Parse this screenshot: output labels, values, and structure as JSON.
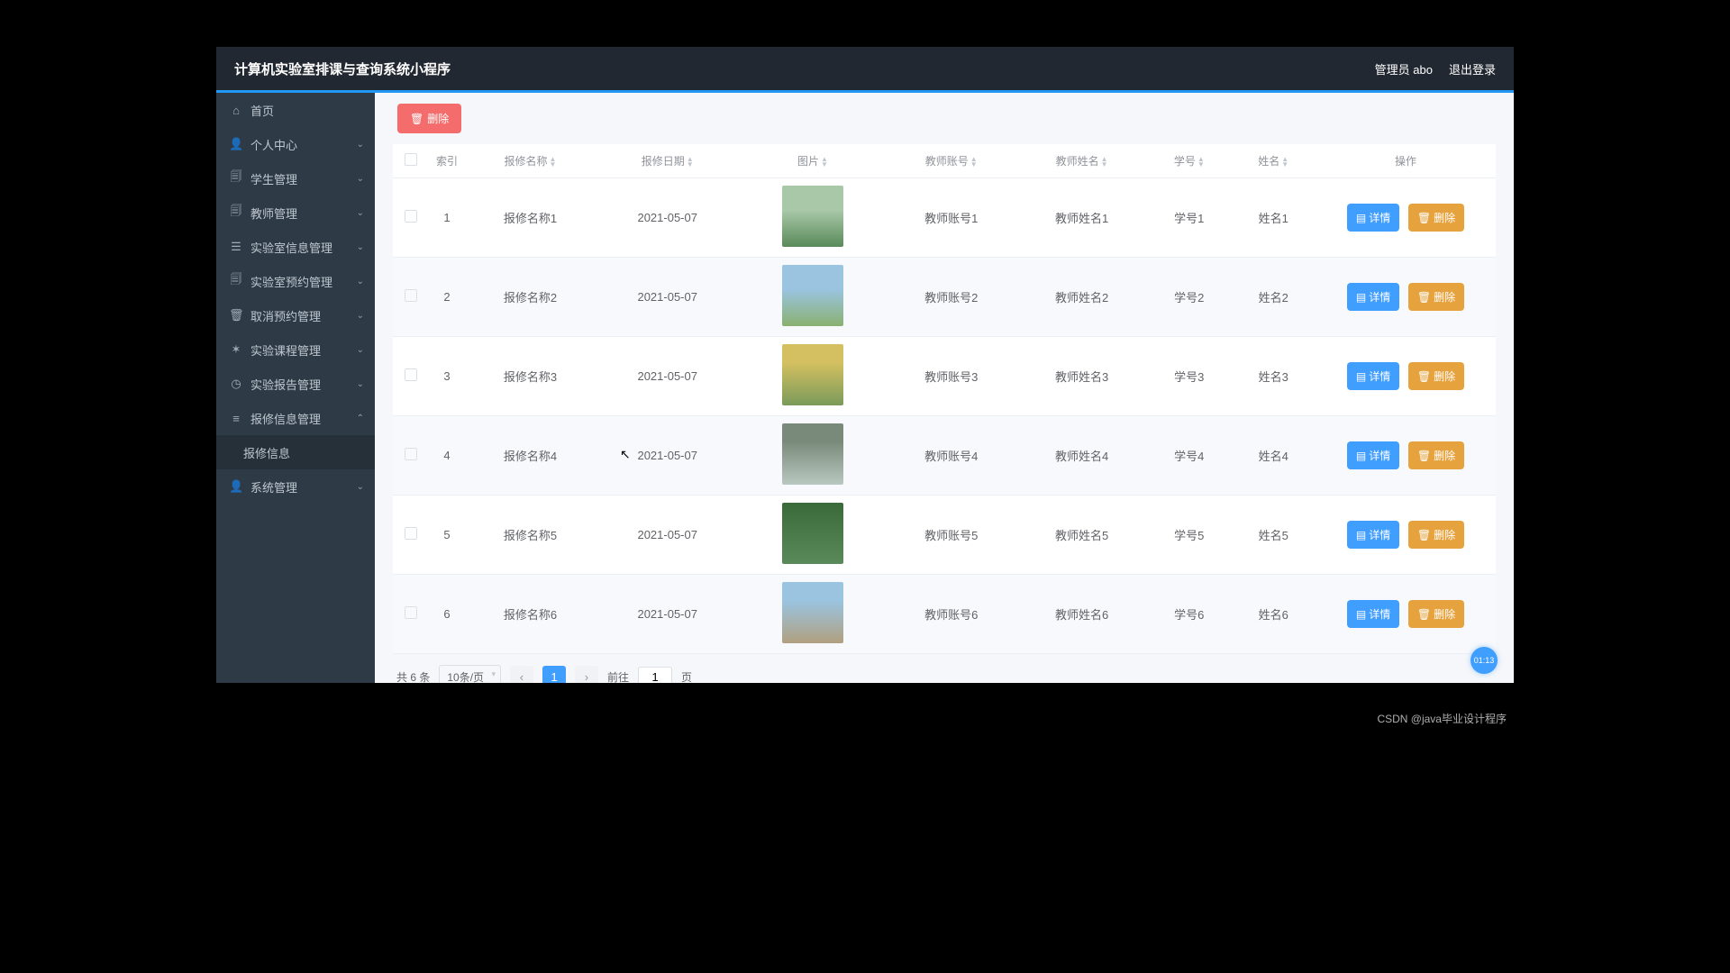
{
  "header": {
    "title": "计算机实验室排课与查询系统小程序",
    "admin_label": "管理员 abo",
    "logout_label": "退出登录"
  },
  "sidebar": {
    "items": [
      {
        "icon": "⌂",
        "label": "首页",
        "chev": ""
      },
      {
        "icon": "👤",
        "label": "个人中心",
        "chev": "⌄"
      },
      {
        "icon": "🗐",
        "label": "学生管理",
        "chev": "⌄"
      },
      {
        "icon": "🗐",
        "label": "教师管理",
        "chev": "⌄"
      },
      {
        "icon": "☰",
        "label": "实验室信息管理",
        "chev": "⌄"
      },
      {
        "icon": "🗐",
        "label": "实验室预约管理",
        "chev": "⌄"
      },
      {
        "icon": "🗑",
        "label": "取消预约管理",
        "chev": "⌄"
      },
      {
        "icon": "✶",
        "label": "实验课程管理",
        "chev": "⌄"
      },
      {
        "icon": "◷",
        "label": "实验报告管理",
        "chev": "⌄"
      },
      {
        "icon": "≡",
        "label": "报修信息管理",
        "chev": "⌃",
        "open": true,
        "sub": "报修信息"
      },
      {
        "icon": "👤",
        "label": "系统管理",
        "chev": "⌄"
      }
    ]
  },
  "toolbar": {
    "delete_label": "删除"
  },
  "table": {
    "headers": {
      "index": "索引",
      "name": "报修名称",
      "date": "报修日期",
      "image": "图片",
      "teacher_account": "教师账号",
      "teacher_name": "教师姓名",
      "student_id": "学号",
      "student_name": "姓名",
      "action": "操作"
    },
    "rows": [
      {
        "idx": "1",
        "name": "报修名称1",
        "date": "2021-05-07",
        "ta": "教师账号1",
        "tn": "教师姓名1",
        "sid": "学号1",
        "sn": "姓名1"
      },
      {
        "idx": "2",
        "name": "报修名称2",
        "date": "2021-05-07",
        "ta": "教师账号2",
        "tn": "教师姓名2",
        "sid": "学号2",
        "sn": "姓名2"
      },
      {
        "idx": "3",
        "name": "报修名称3",
        "date": "2021-05-07",
        "ta": "教师账号3",
        "tn": "教师姓名3",
        "sid": "学号3",
        "sn": "姓名3"
      },
      {
        "idx": "4",
        "name": "报修名称4",
        "date": "2021-05-07",
        "ta": "教师账号4",
        "tn": "教师姓名4",
        "sid": "学号4",
        "sn": "姓名4"
      },
      {
        "idx": "5",
        "name": "报修名称5",
        "date": "2021-05-07",
        "ta": "教师账号5",
        "tn": "教师姓名5",
        "sid": "学号5",
        "sn": "姓名5"
      },
      {
        "idx": "6",
        "name": "报修名称6",
        "date": "2021-05-07",
        "ta": "教师账号6",
        "tn": "教师姓名6",
        "sid": "学号6",
        "sn": "姓名6"
      }
    ],
    "detail_label": "详情",
    "row_delete_label": "删除"
  },
  "pagination": {
    "total_text": "共 6 条",
    "page_size_label": "10条/页",
    "current_page": "1",
    "goto_prefix": "前往",
    "goto_value": "1",
    "goto_suffix": "页"
  },
  "timer": "01:13",
  "watermark": "CSDN @java毕业设计程序"
}
